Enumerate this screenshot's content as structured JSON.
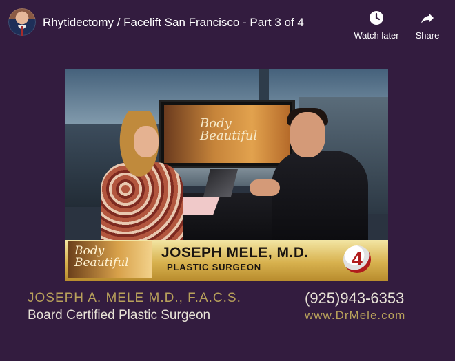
{
  "header": {
    "title": "Rhytidectomy / Facelift San Francisco - Part 3 of 4",
    "actions": [
      {
        "label": "Watch later",
        "icon": "clock-icon"
      },
      {
        "label": "Share",
        "icon": "share-arrow-icon"
      }
    ]
  },
  "video": {
    "monitor_logo": "Body Beautiful",
    "lower_third": {
      "logo": "Body Beautiful",
      "name": "JOSEPH MELE, M.D.",
      "role": "PLASTIC SURGEON",
      "channel": "4"
    }
  },
  "footer": {
    "doctor": "JOSEPH A. MELE M.D., F.A.C.S.",
    "certification": "Board Certified Plastic Surgeon",
    "phone": "(925)943-6353",
    "website": "www.DrMele.com"
  },
  "colors": {
    "background": "#331c3f",
    "gold_text": "#b8a15b",
    "light_text": "#e7e2d6"
  }
}
